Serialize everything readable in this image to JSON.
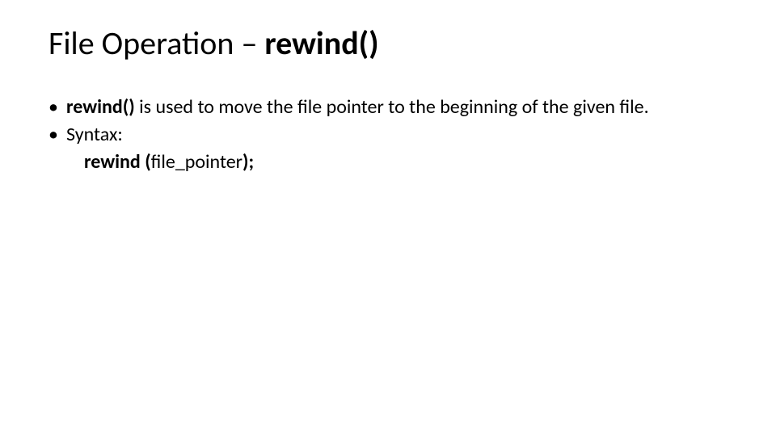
{
  "title": {
    "prefix": "File Operation – ",
    "bold": "rewind()"
  },
  "bullets": {
    "b1": {
      "bold": "rewind()",
      "rest": " is used to move the file pointer to the beginning of the given file."
    },
    "b2": {
      "label": "Syntax:"
    },
    "syntax": {
      "kw": "rewind (",
      "arg": "file_pointer",
      "end": ");"
    }
  }
}
